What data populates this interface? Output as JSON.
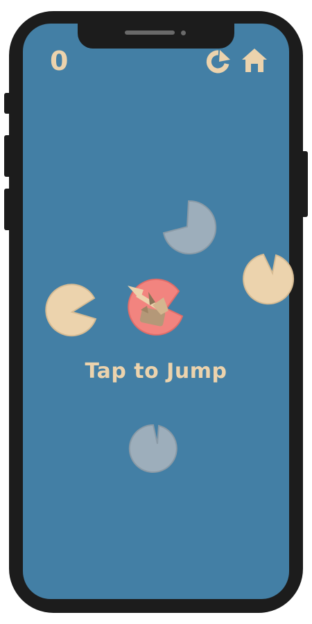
{
  "hud": {
    "score": "0",
    "restart_icon": "restart-icon",
    "home_icon": "home-icon"
  },
  "game": {
    "hint_text": "Tap to Jump",
    "colors": {
      "water": "#437fa5",
      "pad_active": "#ecd3ad",
      "pad_inactive": "#9daebb",
      "pad_current": "#f2847f",
      "frog": "#b49878",
      "text": "#ecd3ad"
    },
    "pads": [
      {
        "id": "pad-top",
        "state": "inactive"
      },
      {
        "id": "pad-right",
        "state": "active"
      },
      {
        "id": "pad-left",
        "state": "active"
      },
      {
        "id": "pad-current",
        "state": "current"
      },
      {
        "id": "pad-bottom",
        "state": "inactive"
      }
    ]
  }
}
